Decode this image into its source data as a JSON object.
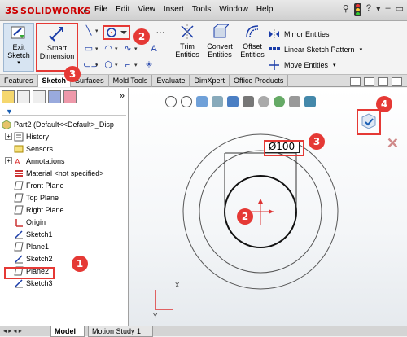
{
  "app": {
    "logo_text": "SOLIDWORKS"
  },
  "menu": [
    "File",
    "Edit",
    "View",
    "Insert",
    "Tools",
    "Window",
    "Help"
  ],
  "ribbon": {
    "exit_sketch_line1": "Exit",
    "exit_sketch_line2": "Sketch",
    "smart_dimension_line1": "Smart",
    "smart_dimension_line2": "Dimension",
    "trim_line1": "Trim",
    "trim_line2": "Entities",
    "convert_line1": "Convert",
    "convert_line2": "Entities",
    "offset_line1": "Offset",
    "offset_line2": "Entities",
    "mirror": "Mirror Entities",
    "linear_pattern": "Linear Sketch Pattern",
    "move": "Move Entities"
  },
  "tabs": [
    "Features",
    "Sketch",
    "Surfaces",
    "Mold Tools",
    "Evaluate",
    "DimXpert",
    "Office Products"
  ],
  "tree": [
    {
      "label": "Part2  (Default<<Default>_Disp",
      "icon": "part-icon",
      "exp": ""
    },
    {
      "label": "History",
      "icon": "history-icon",
      "exp": "+"
    },
    {
      "label": "Sensors",
      "icon": "sensors-icon",
      "exp": ""
    },
    {
      "label": "Annotations",
      "icon": "annotations-icon",
      "exp": "+"
    },
    {
      "label": "Material <not specified>",
      "icon": "material-icon",
      "exp": ""
    },
    {
      "label": "Front Plane",
      "icon": "plane-icon",
      "exp": ""
    },
    {
      "label": "Top Plane",
      "icon": "plane-icon",
      "exp": ""
    },
    {
      "label": "Right Plane",
      "icon": "plane-icon",
      "exp": ""
    },
    {
      "label": "Origin",
      "icon": "origin-icon",
      "exp": ""
    },
    {
      "label": "Sketch1",
      "icon": "sketch-icon",
      "exp": ""
    },
    {
      "label": "Plane1",
      "icon": "plane-icon",
      "exp": ""
    },
    {
      "label": "Sketch2",
      "icon": "sketch-icon",
      "exp": ""
    },
    {
      "label": "Plane2",
      "icon": "plane-icon",
      "exp": ""
    },
    {
      "label": "Sketch3",
      "icon": "sketch-icon",
      "exp": ""
    }
  ],
  "dimension": {
    "text": "Ø100"
  },
  "axes": {
    "x": "X",
    "y": "Y"
  },
  "bottom_tabs": {
    "model": "Model",
    "motion": "Motion Study 1"
  },
  "badges": {
    "b1": "1",
    "b2": "2",
    "b3a": "3",
    "b3b": "3",
    "b4": "4",
    "b2b": "2"
  },
  "colors": {
    "accent": "#e53935",
    "sketch_blue": "#1a3ca8"
  }
}
